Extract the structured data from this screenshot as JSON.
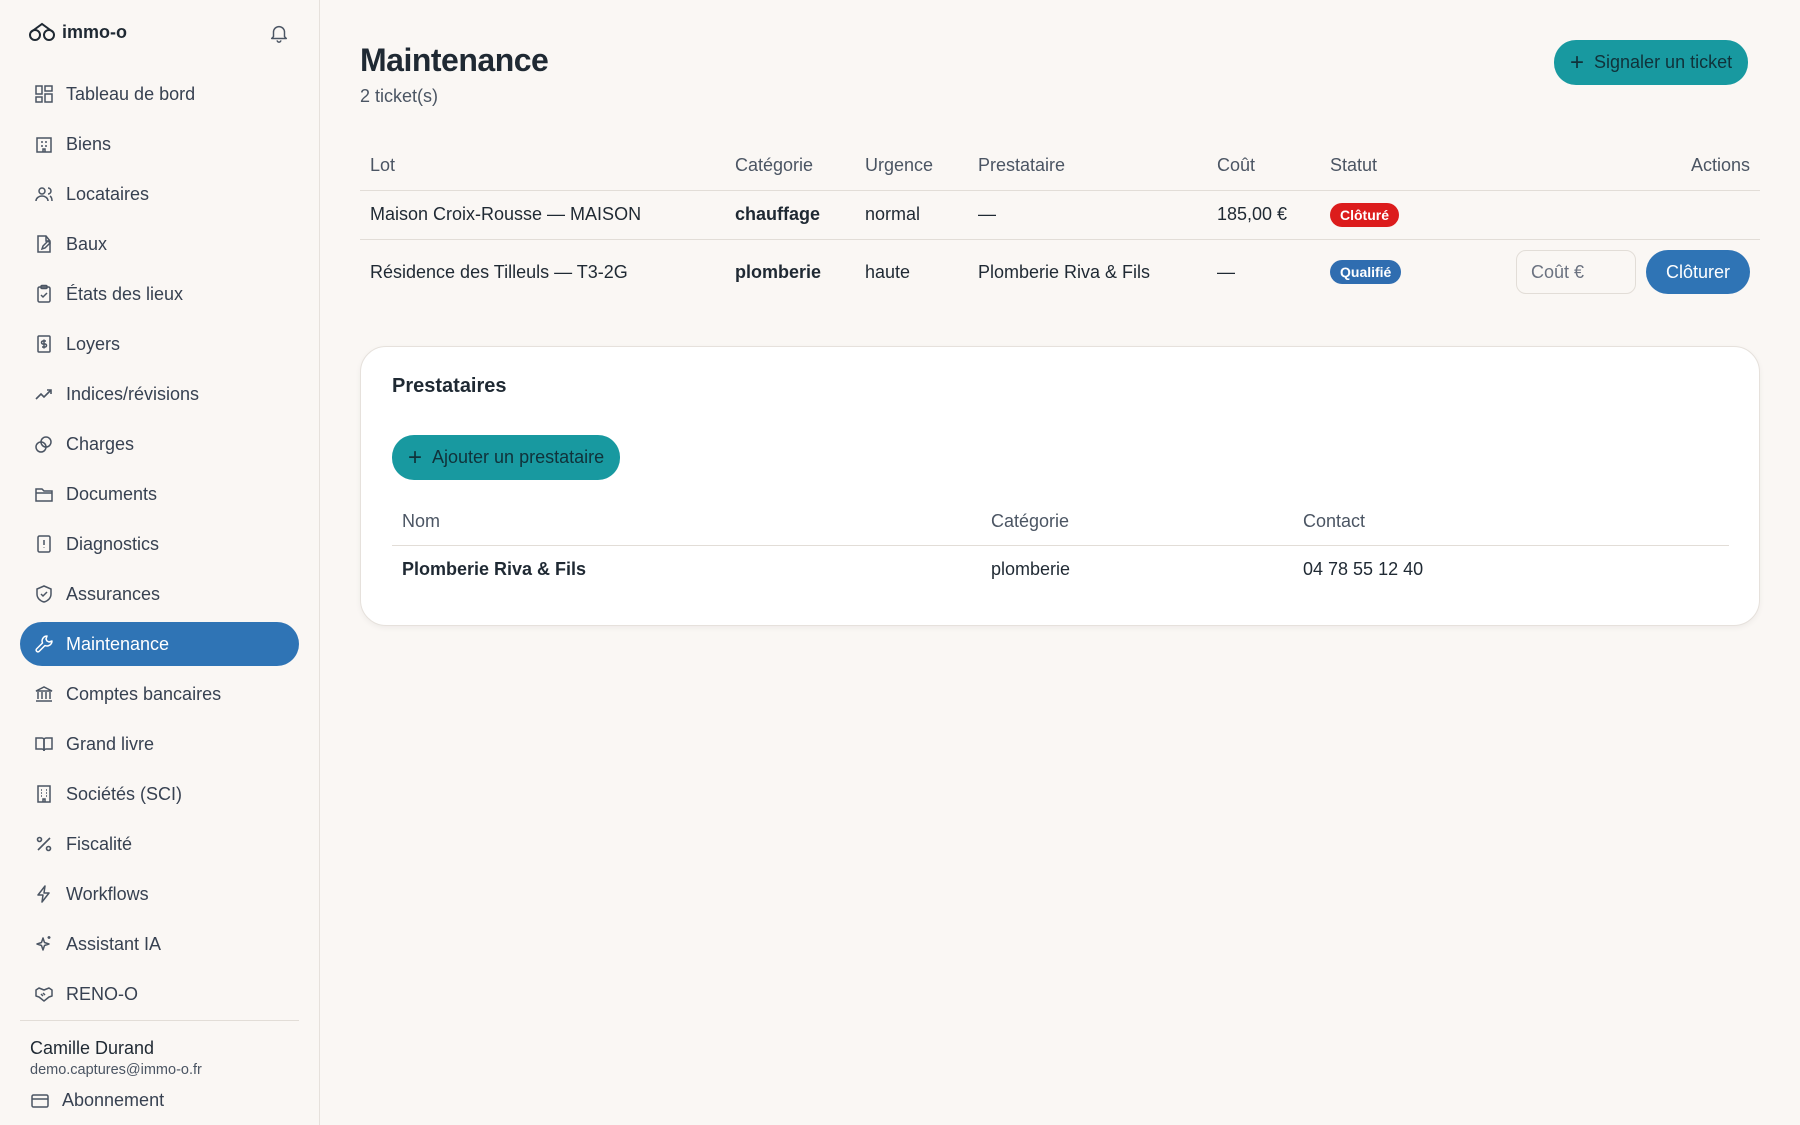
{
  "app": {
    "name": "immo-o"
  },
  "sidebar": {
    "items": [
      {
        "label": "Tableau de bord",
        "icon": "dashboard-icon"
      },
      {
        "label": "Biens",
        "icon": "building-icon"
      },
      {
        "label": "Locataires",
        "icon": "users-icon"
      },
      {
        "label": "Baux",
        "icon": "file-edit-icon"
      },
      {
        "label": "États des lieux",
        "icon": "clipboard-icon"
      },
      {
        "label": "Loyers",
        "icon": "receipt-icon"
      },
      {
        "label": "Indices/révisions",
        "icon": "trend-icon"
      },
      {
        "label": "Charges",
        "icon": "coins-icon"
      },
      {
        "label": "Documents",
        "icon": "folder-icon"
      },
      {
        "label": "Diagnostics",
        "icon": "alert-file-icon"
      },
      {
        "label": "Assurances",
        "icon": "shield-icon"
      },
      {
        "label": "Maintenance",
        "icon": "wrench-icon",
        "active": true
      },
      {
        "label": "Comptes bancaires",
        "icon": "bank-icon"
      },
      {
        "label": "Grand livre",
        "icon": "book-icon"
      },
      {
        "label": "Sociétés (SCI)",
        "icon": "office-icon"
      },
      {
        "label": "Fiscalité",
        "icon": "percent-icon"
      },
      {
        "label": "Workflows",
        "icon": "bolt-icon"
      },
      {
        "label": "Assistant IA",
        "icon": "sparkles-icon"
      },
      {
        "label": "RENO-O",
        "icon": "handshake-icon"
      }
    ],
    "user": {
      "name": "Camille Durand",
      "email": "demo.captures@immo-o.fr"
    },
    "subscription_label": "Abonnement"
  },
  "page": {
    "title": "Maintenance",
    "subtitle": "2 ticket(s)",
    "report_button": "Signaler un ticket"
  },
  "tickets": {
    "headers": {
      "lot": "Lot",
      "category": "Catégorie",
      "urgency": "Urgence",
      "provider": "Prestataire",
      "cost": "Coût",
      "status": "Statut",
      "actions": "Actions"
    },
    "rows": [
      {
        "lot": "Maison Croix-Rousse — MAISON",
        "category": "chauffage",
        "urgency": "normal",
        "provider": "—",
        "cost": "185,00 €",
        "status": "Clôturé",
        "status_color": "#dc1c1c"
      },
      {
        "lot": "Résidence des Tilleuls — T3-2G",
        "category": "plomberie",
        "urgency": "haute",
        "provider": "Plomberie Riva & Fils",
        "cost": "—",
        "status": "Qualifié",
        "status_color": "#2f6db0",
        "cost_placeholder": "Coût €",
        "close_button": "Clôturer"
      }
    ]
  },
  "providers": {
    "title": "Prestataires",
    "add_button": "Ajouter un prestataire",
    "headers": {
      "name": "Nom",
      "category": "Catégorie",
      "contact": "Contact"
    },
    "rows": [
      {
        "name": "Plomberie Riva & Fils",
        "category": "plomberie",
        "contact": "04 78 55 12 40"
      }
    ]
  },
  "colors": {
    "accent_teal": "#1899a0",
    "active_blue": "#2f74b5",
    "background": "#faf7f4"
  }
}
